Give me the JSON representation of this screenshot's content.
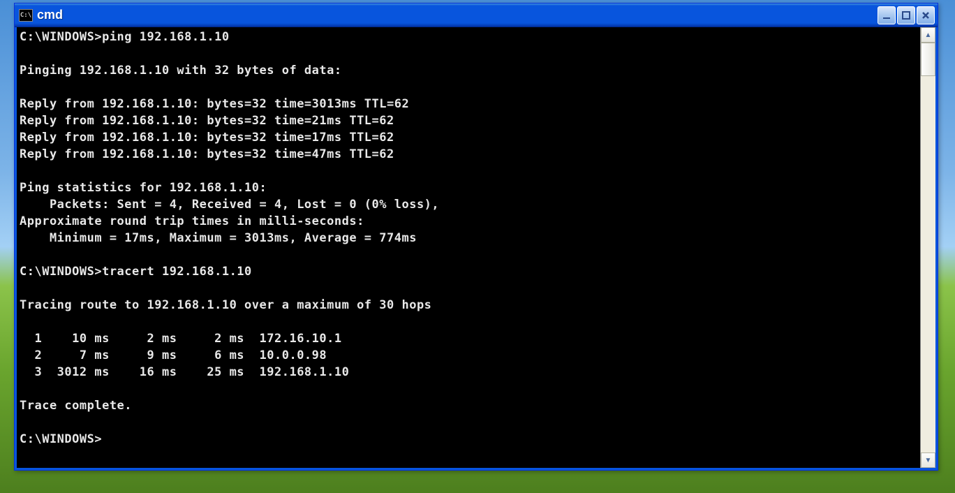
{
  "window": {
    "title": "cmd",
    "icon_text": "C:\\"
  },
  "console": {
    "lines": [
      "C:\\WINDOWS>ping 192.168.1.10",
      "",
      "Pinging 192.168.1.10 with 32 bytes of data:",
      "",
      "Reply from 192.168.1.10: bytes=32 time=3013ms TTL=62",
      "Reply from 192.168.1.10: bytes=32 time=21ms TTL=62",
      "Reply from 192.168.1.10: bytes=32 time=17ms TTL=62",
      "Reply from 192.168.1.10: bytes=32 time=47ms TTL=62",
      "",
      "Ping statistics for 192.168.1.10:",
      "    Packets: Sent = 4, Received = 4, Lost = 0 (0% loss),",
      "Approximate round trip times in milli-seconds:",
      "    Minimum = 17ms, Maximum = 3013ms, Average = 774ms",
      "",
      "C:\\WINDOWS>tracert 192.168.1.10",
      "",
      "Tracing route to 192.168.1.10 over a maximum of 30 hops",
      "",
      "  1    10 ms     2 ms     2 ms  172.16.10.1",
      "  2     7 ms     9 ms     6 ms  10.0.0.98",
      "  3  3012 ms    16 ms    25 ms  192.168.1.10",
      "",
      "Trace complete.",
      "",
      "C:\\WINDOWS>"
    ]
  }
}
